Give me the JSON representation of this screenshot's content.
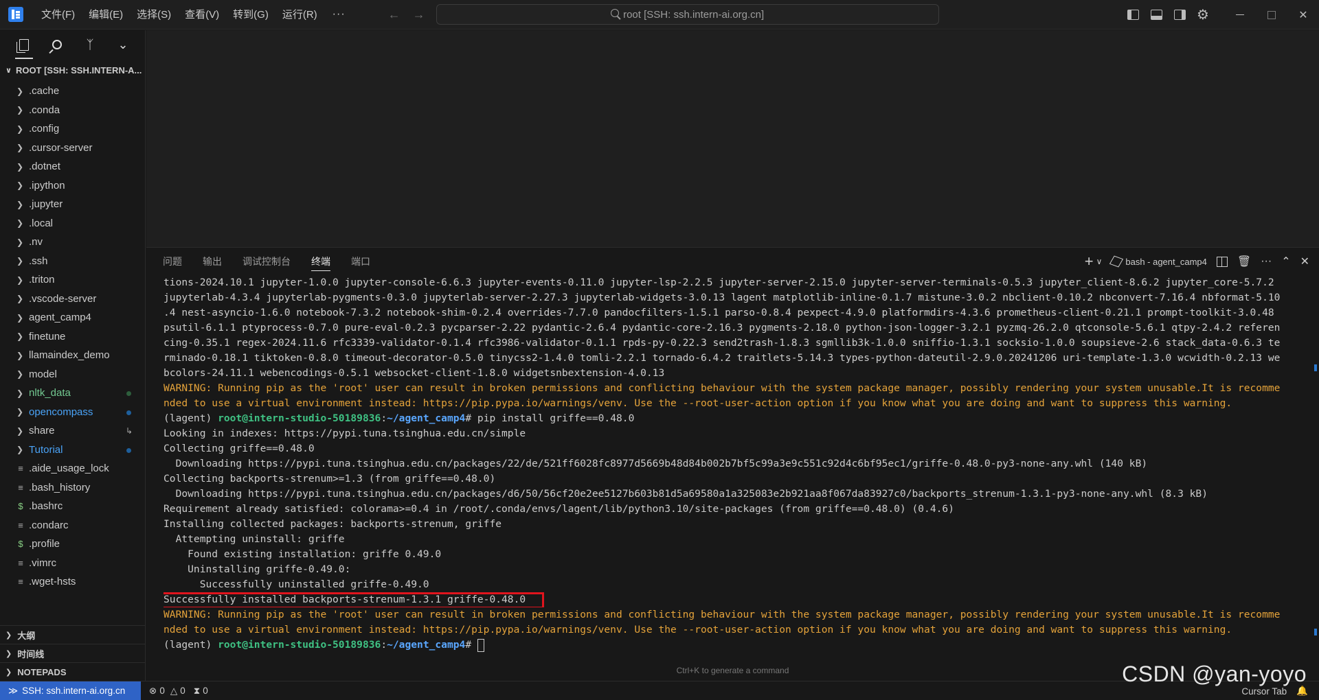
{
  "menu": [
    "文件(F)",
    "编辑(E)",
    "选择(S)",
    "查看(V)",
    "转到(G)",
    "运行(R)"
  ],
  "menu_more": "···",
  "search": {
    "text": "root [SSH: ssh.intern-ai.org.cn]"
  },
  "explorer": {
    "root_label": "ROOT [SSH: SSH.INTERN-A...",
    "items": [
      {
        "label": ".cache",
        "type": "folder",
        "style": ""
      },
      {
        "label": ".conda",
        "type": "folder",
        "style": ""
      },
      {
        "label": ".config",
        "type": "folder",
        "style": ""
      },
      {
        "label": ".cursor-server",
        "type": "folder",
        "style": ""
      },
      {
        "label": ".dotnet",
        "type": "folder",
        "style": ""
      },
      {
        "label": ".ipython",
        "type": "folder",
        "style": ""
      },
      {
        "label": ".jupyter",
        "type": "folder",
        "style": ""
      },
      {
        "label": ".local",
        "type": "folder",
        "style": ""
      },
      {
        "label": ".nv",
        "type": "folder",
        "style": ""
      },
      {
        "label": ".ssh",
        "type": "folder",
        "style": ""
      },
      {
        "label": ".triton",
        "type": "folder",
        "style": ""
      },
      {
        "label": ".vscode-server",
        "type": "folder",
        "style": ""
      },
      {
        "label": "agent_camp4",
        "type": "folder",
        "style": ""
      },
      {
        "label": "finetune",
        "type": "folder",
        "style": ""
      },
      {
        "label": "llamaindex_demo",
        "type": "folder",
        "style": ""
      },
      {
        "label": "model",
        "type": "folder",
        "style": ""
      },
      {
        "label": "nltk_data",
        "type": "folder",
        "style": "green"
      },
      {
        "label": "opencompass",
        "type": "folder",
        "style": "blue"
      },
      {
        "label": "share",
        "type": "folder",
        "style": "link"
      },
      {
        "label": "Tutorial",
        "type": "folder",
        "style": "blue"
      },
      {
        "label": ".aide_usage_lock",
        "type": "file",
        "style": ""
      },
      {
        "label": ".bash_history",
        "type": "file",
        "style": ""
      },
      {
        "label": ".bashrc",
        "type": "shell",
        "style": ""
      },
      {
        "label": ".condarc",
        "type": "file",
        "style": ""
      },
      {
        "label": ".profile",
        "type": "shell",
        "style": ""
      },
      {
        "label": ".vimrc",
        "type": "file",
        "style": ""
      },
      {
        "label": ".wget-hsts",
        "type": "file",
        "style": ""
      }
    ],
    "bottom_sections": [
      "大纲",
      "时间线",
      "NOTEPADS"
    ]
  },
  "panel": {
    "tabs": [
      "问题",
      "输出",
      "调试控制台",
      "终端",
      "端口"
    ],
    "active_tab": "终端",
    "terminal_name": "bash - agent_camp4",
    "generate_hint": "Ctrl+K to generate a command"
  },
  "terminal": {
    "lines": [
      {
        "kind": "plain",
        "text": "tions-2024.10.1 jupyter-1.0.0 jupyter-console-6.6.3 jupyter-events-0.11.0 jupyter-lsp-2.2.5 jupyter-server-2.15.0 jupyter-server-terminals-0.5.3 jupyter_client-8.6.2 jupyter_core-5.7.2"
      },
      {
        "kind": "plain",
        "text": "jupyterlab-4.3.4 jupyterlab-pygments-0.3.0 jupyterlab-server-2.27.3 jupyterlab-widgets-3.0.13 lagent matplotlib-inline-0.1.7 mistune-3.0.2 nbclient-0.10.2 nbconvert-7.16.4 nbformat-5.10"
      },
      {
        "kind": "plain",
        "text": ".4 nest-asyncio-1.6.0 notebook-7.3.2 notebook-shim-0.2.4 overrides-7.7.0 pandocfilters-1.5.1 parso-0.8.4 pexpect-4.9.0 platformdirs-4.3.6 prometheus-client-0.21.1 prompt-toolkit-3.0.48"
      },
      {
        "kind": "plain",
        "text": "psutil-6.1.1 ptyprocess-0.7.0 pure-eval-0.2.3 pycparser-2.22 pydantic-2.6.4 pydantic-core-2.16.3 pygments-2.18.0 python-json-logger-3.2.1 pyzmq-26.2.0 qtconsole-5.6.1 qtpy-2.4.2 referen"
      },
      {
        "kind": "plain",
        "text": "cing-0.35.1 regex-2024.11.6 rfc3339-validator-0.1.4 rfc3986-validator-0.1.1 rpds-py-0.22.3 send2trash-1.8.3 sgmllib3k-1.0.0 sniffio-1.3.1 socksio-1.0.0 soupsieve-2.6 stack_data-0.6.3 te"
      },
      {
        "kind": "plain",
        "text": "rminado-0.18.1 tiktoken-0.8.0 timeout-decorator-0.5.0 tinycss2-1.4.0 tomli-2.2.1 tornado-6.4.2 traitlets-5.14.3 types-python-dateutil-2.9.0.20241206 uri-template-1.3.0 wcwidth-0.2.13 we"
      },
      {
        "kind": "plain",
        "text": "bcolors-24.11.1 webencodings-0.5.1 websocket-client-1.8.0 widgetsnbextension-4.0.13"
      },
      {
        "kind": "warn",
        "text": "WARNING: Running pip as the 'root' user can result in broken permissions and conflicting behaviour with the system package manager, possibly rendering your system unusable.It is recomme"
      },
      {
        "kind": "warn",
        "text": "nded to use a virtual environment instead: https://pip.pypa.io/warnings/venv. Use the --root-user-action option if you know what you are doing and want to suppress this warning."
      },
      {
        "kind": "prompt",
        "env": "(lagent) ",
        "user": "root@intern-studio-50189836",
        "sep": ":",
        "path": "~/agent_camp4",
        "cmd": "# pip install griffe==0.48.0",
        "gutter": "filled"
      },
      {
        "kind": "plain",
        "text": "Looking in indexes: https://pypi.tuna.tsinghua.edu.cn/simple"
      },
      {
        "kind": "plain",
        "text": "Collecting griffe==0.48.0"
      },
      {
        "kind": "plain",
        "text": "  Downloading https://pypi.tuna.tsinghua.edu.cn/packages/22/de/521ff6028fc8977d5669b48d84b002b7bf5c99a3e9c551c92d4c6bf95ec1/griffe-0.48.0-py3-none-any.whl (140 kB)"
      },
      {
        "kind": "plain",
        "text": "Collecting backports-strenum>=1.3 (from griffe==0.48.0)"
      },
      {
        "kind": "plain",
        "text": "  Downloading https://pypi.tuna.tsinghua.edu.cn/packages/d6/50/56cf20e2ee5127b603b81d5a69580a1a325083e2b921aa8f067da83927c0/backports_strenum-1.3.1-py3-none-any.whl (8.3 kB)"
      },
      {
        "kind": "plain",
        "text": "Requirement already satisfied: colorama>=0.4 in /root/.conda/envs/lagent/lib/python3.10/site-packages (from griffe==0.48.0) (0.4.6)"
      },
      {
        "kind": "plain",
        "text": "Installing collected packages: backports-strenum, griffe"
      },
      {
        "kind": "plain",
        "text": "  Attempting uninstall: griffe"
      },
      {
        "kind": "plain",
        "text": "    Found existing installation: griffe 0.49.0"
      },
      {
        "kind": "plain",
        "text": "    Uninstalling griffe-0.49.0:"
      },
      {
        "kind": "plain",
        "text": "      Successfully uninstalled griffe-0.49.0"
      },
      {
        "kind": "highlight",
        "text": "Successfully installed backports-strenum-1.3.1 griffe-0.48.0"
      },
      {
        "kind": "warn",
        "text": "WARNING: Running pip as the 'root' user can result in broken permissions and conflicting behaviour with the system package manager, possibly rendering your system unusable.It is recomme"
      },
      {
        "kind": "warn",
        "text": "nded to use a virtual environment instead: https://pip.pypa.io/warnings/venv. Use the --root-user-action option if you know what you are doing and want to suppress this warning."
      },
      {
        "kind": "prompt",
        "env": "(lagent) ",
        "user": "root@intern-studio-50189836",
        "sep": ":",
        "path": "~/agent_camp4",
        "cmd": "# ",
        "gutter": "hollow",
        "cursor": true
      }
    ]
  },
  "statusbar": {
    "remote": "SSH: ssh.intern-ai.org.cn",
    "errors": "0",
    "warnings": "0",
    "ports": "0",
    "cursor_tab": "Cursor Tab"
  },
  "watermark": "CSDN @yan-yoyo",
  "colors": {
    "remote_bg": "#2f63c6",
    "warning_text": "#e5a33a",
    "prompt_user": "#3fc183",
    "prompt_path": "#5aa7ff",
    "highlight_border": "#e0141d"
  }
}
